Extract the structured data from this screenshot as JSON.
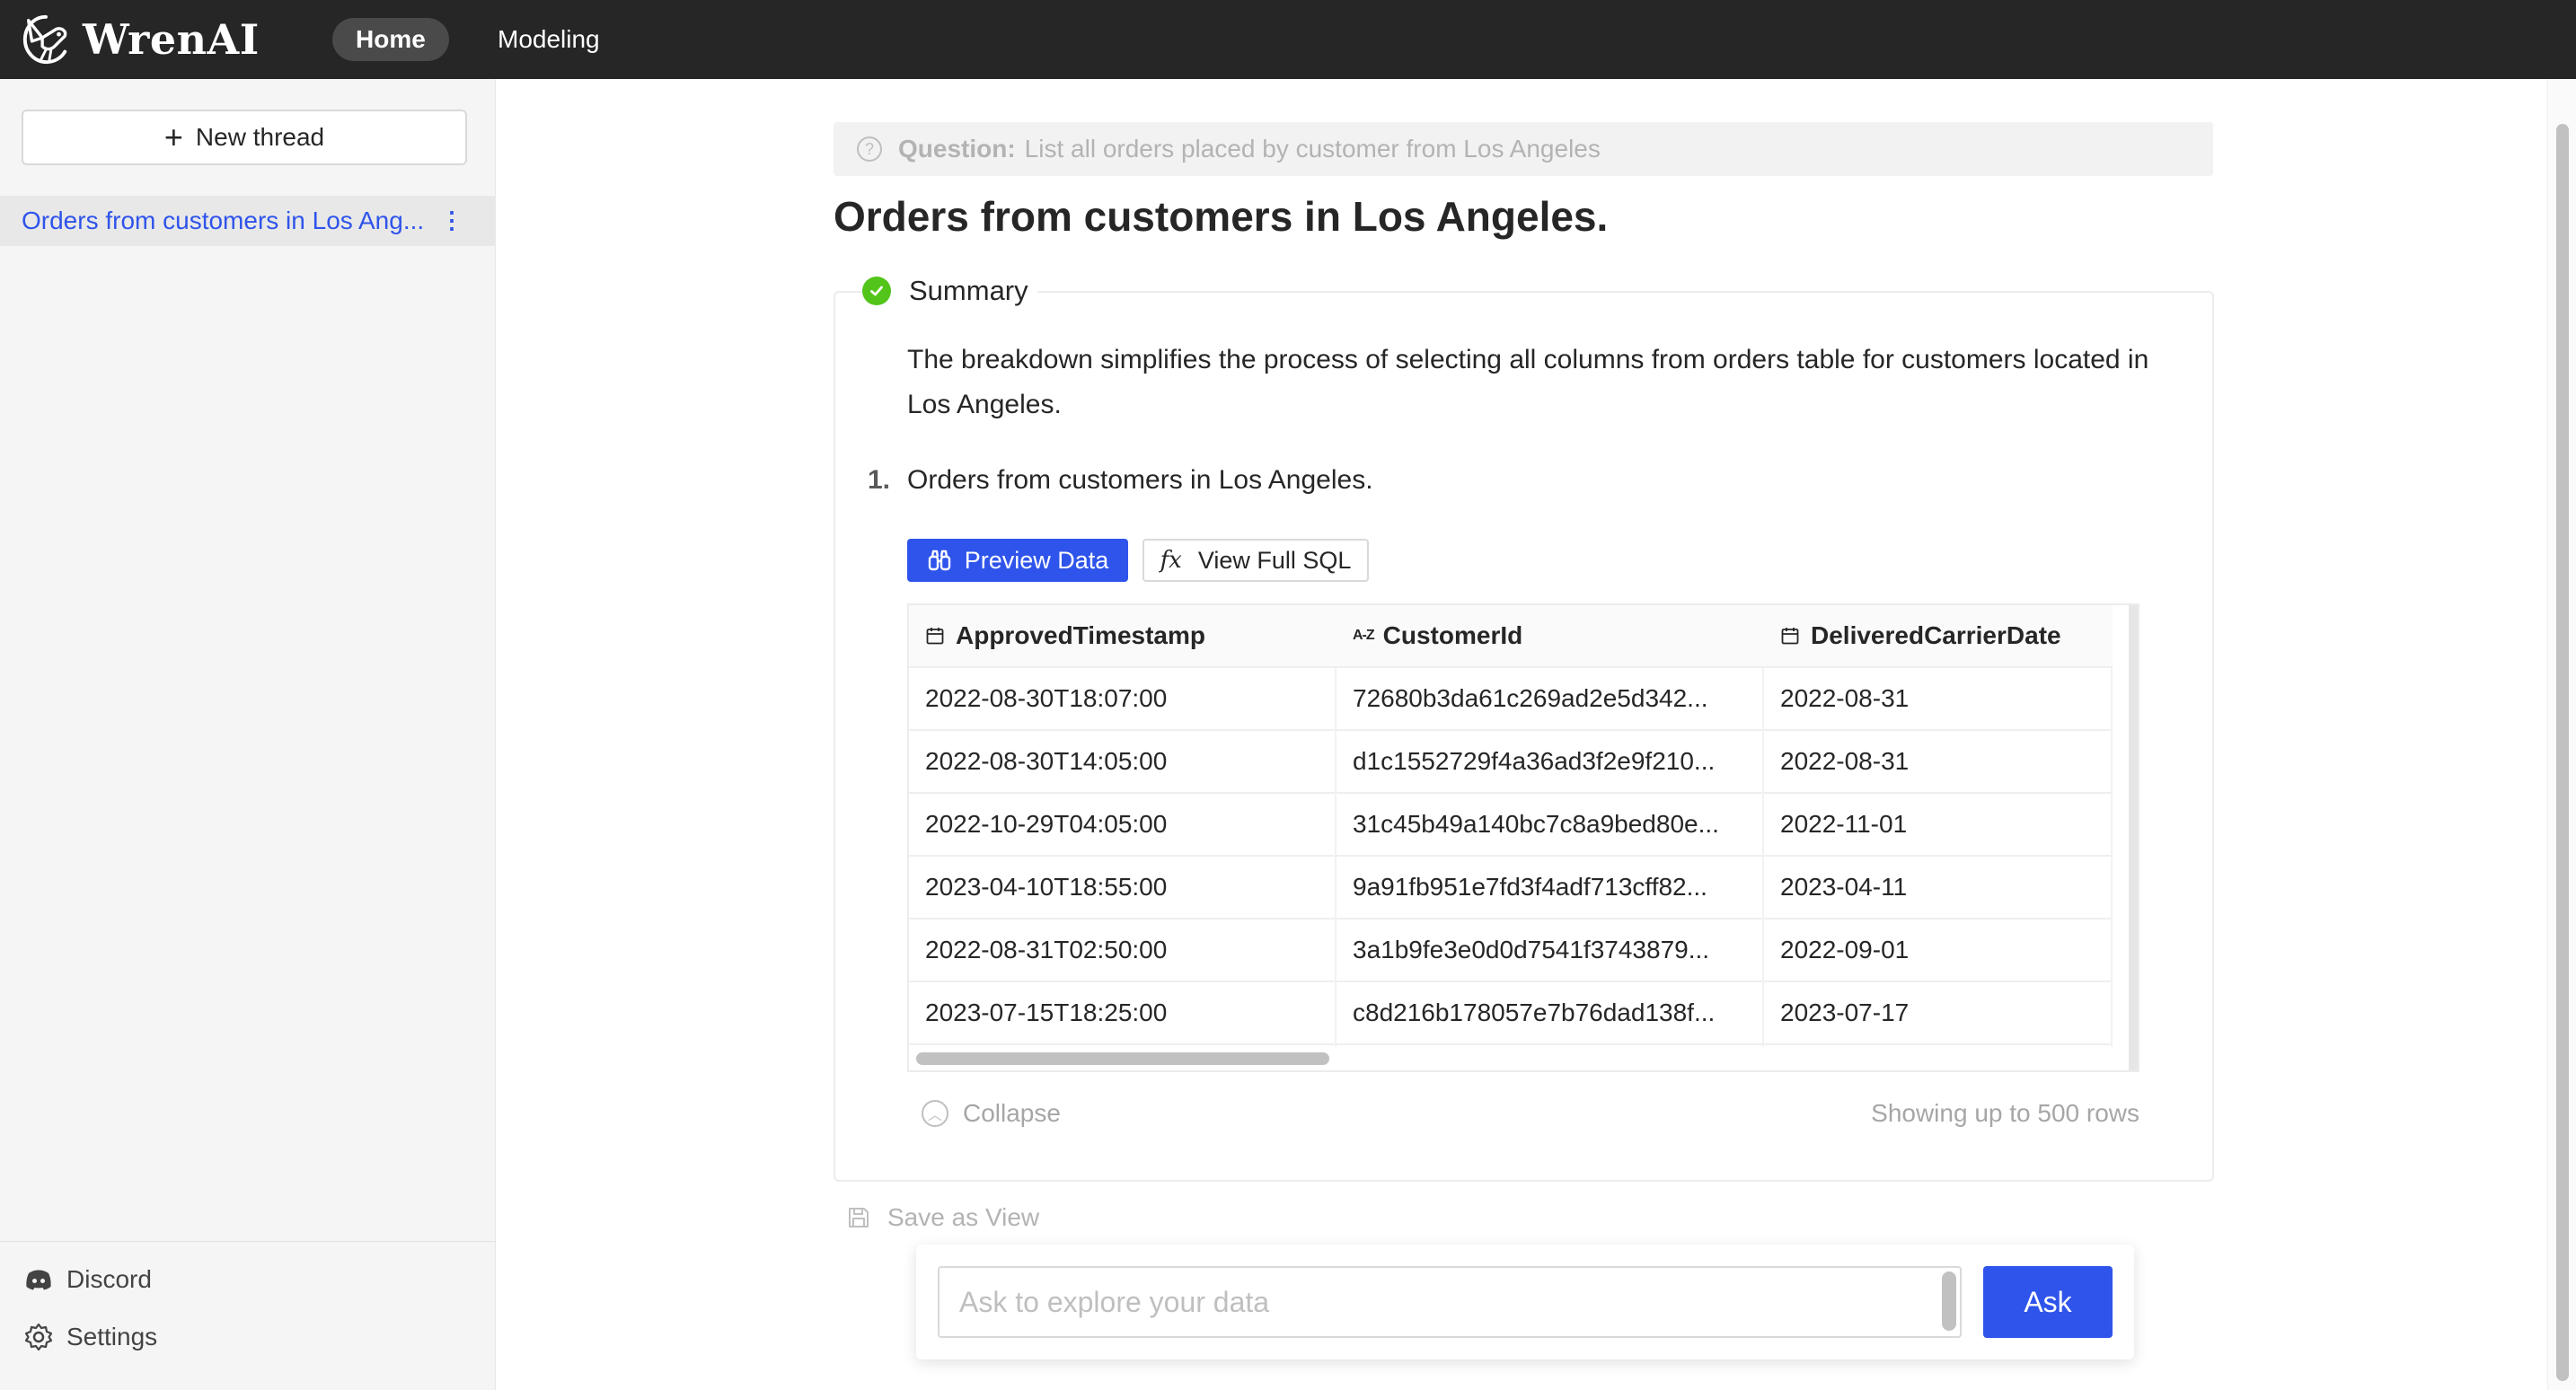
{
  "app": {
    "brand": "WrenAI",
    "nav": [
      {
        "label": "Home",
        "active": true
      },
      {
        "label": "Modeling",
        "active": false
      }
    ]
  },
  "sidebar": {
    "new_thread_label": "New thread",
    "threads": [
      {
        "label": "Orders from customers in Los Ang...",
        "selected": true
      }
    ],
    "footer": [
      {
        "label": "Discord",
        "icon": "discord-icon"
      },
      {
        "label": "Settings",
        "icon": "gear-icon"
      }
    ]
  },
  "main": {
    "question_label": "Question:",
    "question_text": "List all orders placed by customer from Los Angeles",
    "title": "Orders from customers in Los Angeles.",
    "summary": {
      "heading": "Summary",
      "text": "The breakdown simplifies the process of selecting all columns from orders table for customers located in Los Angeles.",
      "steps": [
        {
          "number": "1.",
          "text": "Orders from customers in Los Angeles."
        }
      ]
    },
    "buttons": {
      "preview": "Preview Data",
      "view_sql": "View Full SQL"
    },
    "table": {
      "columns": [
        {
          "label": "ApprovedTimestamp",
          "type_icon": "calendar-icon"
        },
        {
          "label": "CustomerId",
          "type_icon": "text-type-icon",
          "type_text": "A-Z"
        },
        {
          "label": "DeliveredCarrierDate",
          "type_icon": "calendar-icon"
        }
      ],
      "rows": [
        [
          "2022-08-30T18:07:00",
          "72680b3da61c269ad2e5d342...",
          "2022-08-31"
        ],
        [
          "2022-08-30T14:05:00",
          "d1c1552729f4a36ad3f2e9f210...",
          "2022-08-31"
        ],
        [
          "2022-10-29T04:05:00",
          "31c45b49a140bc7c8a9bed80e...",
          "2022-11-01"
        ],
        [
          "2023-04-10T18:55:00",
          "9a91fb951e7fd3f4adf713cff82...",
          "2023-04-11"
        ],
        [
          "2022-08-31T02:50:00",
          "3a1b9fe3e0d0d7541f3743879...",
          "2022-09-01"
        ],
        [
          "2023-07-15T18:25:00",
          "c8d216b178057e7b76dad138f...",
          "2023-07-17"
        ]
      ]
    },
    "collapse_label": "Collapse",
    "showing_text": "Showing up to 500 rows",
    "save_view_label": "Save as View"
  },
  "ask": {
    "placeholder": "Ask to explore your data",
    "value": "",
    "button": "Ask"
  },
  "colors": {
    "topbar": "#262626",
    "accent": "#2f54eb",
    "success": "#52c41a"
  }
}
